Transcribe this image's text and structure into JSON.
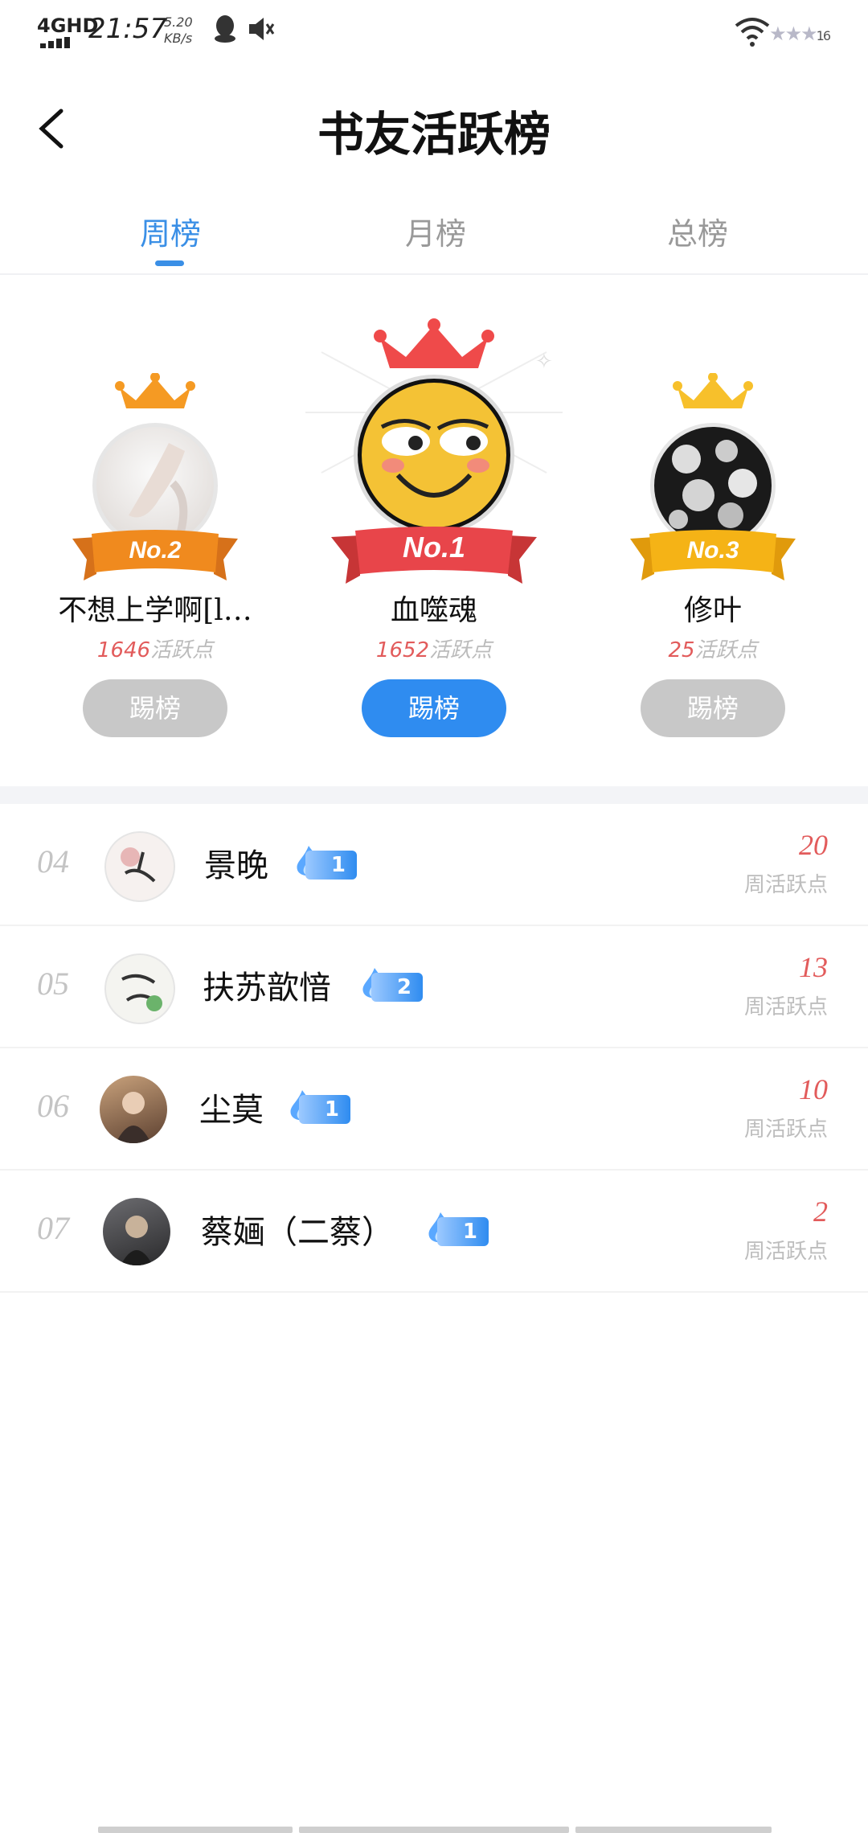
{
  "status": {
    "network": "4GHD",
    "time": "21:57",
    "speed_value": "5.20",
    "speed_unit": "KB/s",
    "battery": "16"
  },
  "header": {
    "title": "书友活跃榜"
  },
  "tabs": [
    {
      "label": "周榜",
      "active": true
    },
    {
      "label": "月榜",
      "active": false
    },
    {
      "label": "总榜",
      "active": false
    }
  ],
  "podium": [
    {
      "rank": "No.2",
      "name": "不想上学啊[l…",
      "points": "1646",
      "points_suffix": "活跃点",
      "button": "踢榜",
      "crown_color": "#f59a23",
      "ribbon_color": "#f08a1e"
    },
    {
      "rank": "No.1",
      "name": "血噬魂",
      "points": "1652",
      "points_suffix": "活跃点",
      "button": "踢榜",
      "crown_color": "#ef4a4a",
      "ribbon_color": "#e8454a"
    },
    {
      "rank": "No.3",
      "name": "修叶",
      "points": "25",
      "points_suffix": "活跃点",
      "button": "踢榜",
      "crown_color": "#f7c02b",
      "ribbon_color": "#f5b316"
    }
  ],
  "list": [
    {
      "rank": "04",
      "name": "景晚",
      "badge": "1",
      "score": "20",
      "score_label": "周活跃点"
    },
    {
      "rank": "05",
      "name": "扶苏歆愔",
      "badge": "2",
      "score": "13",
      "score_label": "周活跃点"
    },
    {
      "rank": "06",
      "name": "尘莫",
      "badge": "1",
      "score": "10",
      "score_label": "周活跃点"
    },
    {
      "rank": "07",
      "name": "蔡婳（二蔡）",
      "badge": "1",
      "score": "2",
      "score_label": "周活跃点"
    }
  ],
  "icons": {
    "back": "chevron-left-icon",
    "fire": "flame-icon",
    "crown": "crown-icon"
  },
  "colors": {
    "accent": "#2f8cf0",
    "points": "#e25b5b",
    "muted": "#bdbdbd"
  }
}
